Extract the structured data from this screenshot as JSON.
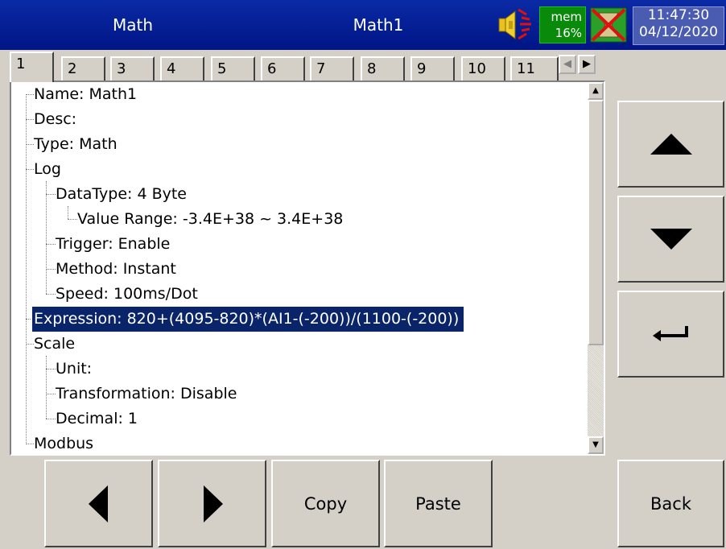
{
  "header": {
    "left_title": "Math",
    "center_title": "Math1",
    "mem_label": "mem",
    "mem_value": "16%",
    "time": "11:47:30",
    "date": "04/12/2020"
  },
  "tabs": [
    "1",
    "2",
    "3",
    "4",
    "5",
    "6",
    "7",
    "8",
    "9",
    "10",
    "11"
  ],
  "active_tab": "1",
  "tree": {
    "name": "Name: Math1",
    "desc": "Desc:",
    "type": "Type: Math",
    "log": "Log",
    "datatype": "DataType: 4 Byte",
    "value_range": "Value Range: -3.4E+38  ~ 3.4E+38",
    "trigger": "Trigger: Enable",
    "method": "Method: Instant",
    "speed": "Speed: 100ms/Dot",
    "expression": "Expression: 820+(4095-820)*(AI1-(-200))/(1100-(-200))",
    "scale": "Scale",
    "unit": "Unit:",
    "transformation": "Transformation: Disable",
    "decimal": "Decimal: 1",
    "modbus": "Modbus"
  },
  "buttons": {
    "copy": "Copy",
    "paste": "Paste",
    "back": "Back"
  },
  "icons": {
    "tab_left": "◀",
    "tab_right": "▶",
    "scroll_up": "▲",
    "scroll_down": "▼"
  },
  "colors": {
    "header_bg": "#001a8f",
    "selection_bg": "#0a246a",
    "mem_bg": "#0a8a0a",
    "datetime_bg": "#4a5cb2",
    "panel_bg": "#d4d0c8"
  }
}
